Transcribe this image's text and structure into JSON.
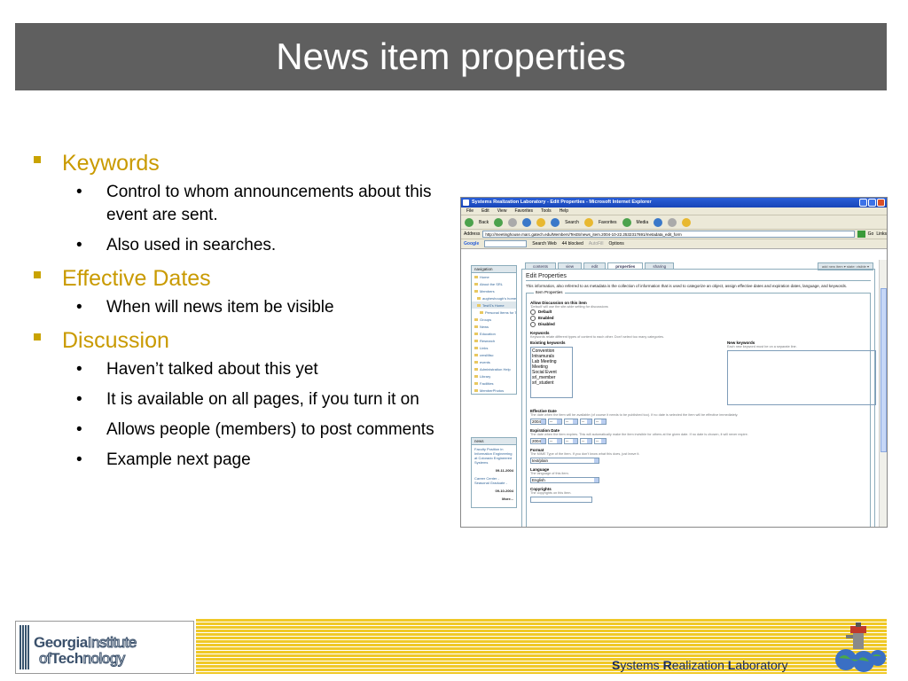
{
  "slide": {
    "title": "News item properties"
  },
  "bullets": [
    {
      "heading": "Keywords",
      "subs": [
        "Control to whom announcements about this event are sent.",
        "Also used in searches."
      ]
    },
    {
      "heading": "Effective Dates",
      "subs": [
        "When will news item be visible"
      ]
    },
    {
      "heading": "Discussion",
      "subs": [
        "Haven’t talked about this yet",
        "It is available on all pages, if you turn it on",
        "Allows people (members) to post comments",
        "Example next page"
      ]
    }
  ],
  "screenshot": {
    "window_title": "Systems Realization Laboratory - Edit Properties - Microsoft Internet Explorer",
    "menu": [
      "File",
      "Edit",
      "View",
      "Favorites",
      "Tools",
      "Help"
    ],
    "toolbar": {
      "back": "Back",
      "search": "Search",
      "favorites": "Favorites",
      "media": "Media"
    },
    "address_label": "Address",
    "address": "http://meetinghouse.marc.gatech.edu/Members/TestS/news_item.2004-10-22.2532317691/metadata_edit_form",
    "go": "Go",
    "links": "Links",
    "google": {
      "label": "Google",
      "search_web": "Search Web",
      "blocked": "44 blocked",
      "autofill": "AutoFill",
      "options": "Options"
    },
    "tabs": [
      "contents",
      "view",
      "edit",
      "properties",
      "sharing"
    ],
    "right_tab": "add new item ▾  state: visible ▾",
    "nav": {
      "header": "navigation",
      "items": [
        "Home",
        "About the SRL",
        "Members",
        "augheshough's home",
        "TestS's Home",
        "Personal Items for TestS",
        "Groups",
        "News",
        "Education",
        "Research",
        "Links",
        "cmsMisc",
        "events",
        "Administration Help",
        "Library",
        "Facilities",
        "MemberPhotos"
      ]
    },
    "news": {
      "header": "news",
      "item1": "Faculty Position in Information Engineering at Colorado Engineered Systems",
      "date1": "09-11-2004",
      "item2": "Career Center - Seasonal Graduate -",
      "date2": "09-10-2004",
      "more": "More..."
    },
    "form": {
      "heading": "Edit Properties",
      "description": "This information, also referred to as metadata is the collection of information that is used to categorize an object, assign effective dates and expiration dates, language, and keywords.",
      "legend": "Item Properties",
      "discussion_label": "Allow Discussion on this item",
      "discussion_help": "'Default' will use the site-wide setting for discussions",
      "options": [
        "Default",
        "Enabled",
        "Disabled"
      ],
      "keywords_label": "Keywords",
      "keywords_help": "Keywords relate different types of content to each other. Don't select too many categories.",
      "existing_label": "Existing keywords",
      "new_label": "New keywords",
      "new_help": "Each new keyword must be on a separate line.",
      "keywords": [
        "Convention",
        "Intramurals",
        "Lab Meeting",
        "Meeting",
        "Social Event",
        "srl_member",
        "srl_student"
      ],
      "effective_label": "Effective Date",
      "effective_help": "The date when the item will be available (of course it needs to be published too). If no date is selected the item will be effective immediately.",
      "year": "2004",
      "dash": "--",
      "expiration_label": "Expiration Date",
      "expiration_help": "The date when the item expires. This will automatically make the item invisible for others at the given date. If no date is chosen, it will never expire.",
      "format_label": "Format",
      "format_help": "The MIME Type of the item. If you don't know what this does, just leave it.",
      "format_value": "text/plain",
      "language_label": "Language",
      "language_help": "The language of this item.",
      "language_value": "English",
      "copyright_label": "Copyrights",
      "copyright_help": "The copyrights on this item."
    }
  },
  "footer": {
    "logo_line1_bold": "Georgia",
    "logo_line1": "Institute",
    "logo_line2_pre": "of",
    "logo_line2_bold": "Tech",
    "logo_line2": "nology",
    "lab_s": "S",
    "lab_1": "ystems ",
    "lab_r": "R",
    "lab_2": "ealization ",
    "lab_l": "L",
    "lab_3": "aboratory"
  }
}
